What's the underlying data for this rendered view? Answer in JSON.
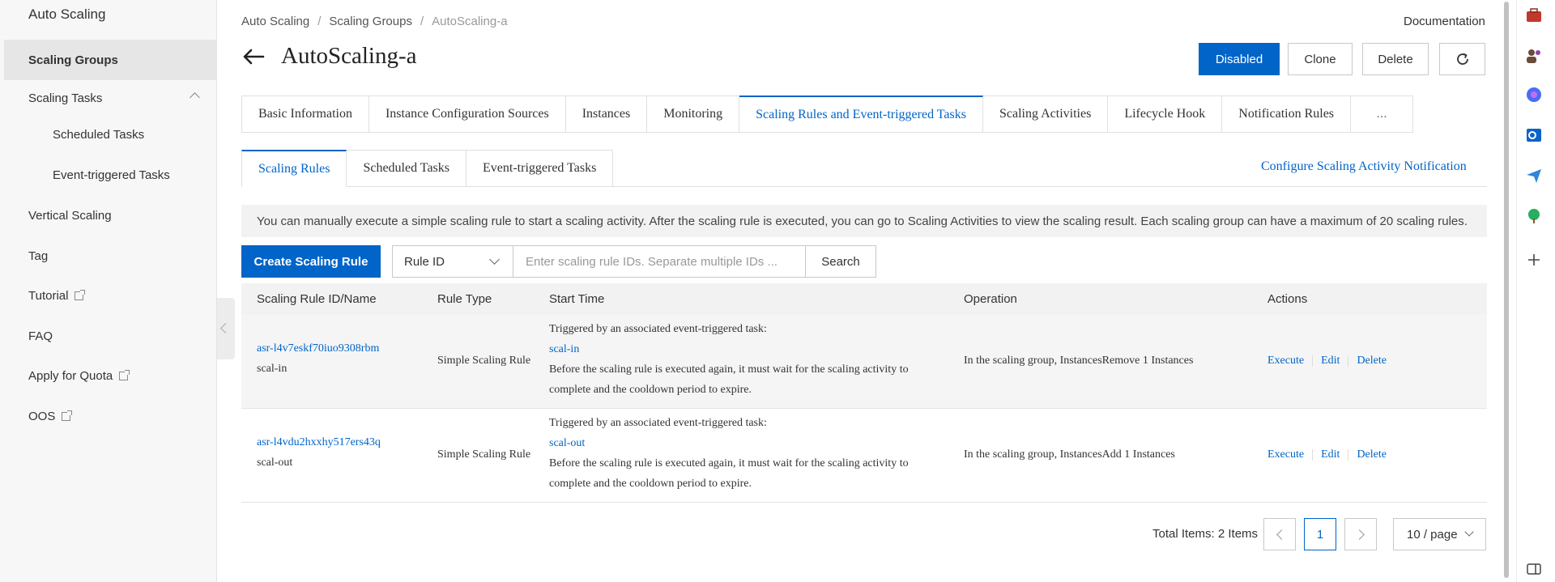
{
  "sidebar": {
    "title": "Auto Scaling",
    "items": [
      {
        "label": "Scaling Groups"
      },
      {
        "label": "Scaling Tasks"
      },
      {
        "label": "Scheduled Tasks"
      },
      {
        "label": "Event-triggered Tasks"
      },
      {
        "label": "Vertical Scaling"
      },
      {
        "label": "Tag"
      },
      {
        "label": "Tutorial"
      },
      {
        "label": "FAQ"
      },
      {
        "label": "Apply for Quota"
      },
      {
        "label": "OOS"
      }
    ]
  },
  "header": {
    "breadcrumb": [
      "Auto Scaling",
      "Scaling Groups",
      "AutoScaling-a"
    ],
    "breadcrumb_sep": "/",
    "documentation": "Documentation",
    "title": "AutoScaling-a",
    "buttons": {
      "disabled": "Disabled",
      "clone": "Clone",
      "delete": "Delete"
    }
  },
  "tabs": [
    "Basic Information",
    "Instance Configuration Sources",
    "Instances",
    "Monitoring",
    "Scaling Rules and Event-triggered Tasks",
    "Scaling Activities",
    "Lifecycle Hook",
    "Notification Rules",
    "..."
  ],
  "subtabs": [
    "Scaling Rules",
    "Scheduled Tasks",
    "Event-triggered Tasks"
  ],
  "notify_link": "Configure Scaling Activity Notification",
  "info": "You can manually execute a simple scaling rule to start a scaling activity. After the scaling rule is executed, you can go to Scaling Activities to view the scaling result. Each scaling group can have a maximum of 20 scaling rules.",
  "toolbar": {
    "create": "Create Scaling Rule",
    "select_value": "Rule ID",
    "search_placeholder": "Enter scaling rule IDs. Separate multiple IDs ...",
    "search": "Search"
  },
  "table": {
    "columns": [
      "Scaling Rule ID/Name",
      "Rule Type",
      "Start Time",
      "Operation",
      "Actions"
    ],
    "rows": [
      {
        "id": "asr-l4v7eskf70iuo9308rbm",
        "name": "scal-in",
        "type": "Simple Scaling Rule",
        "start_line1": "Triggered by an associated event-triggered task:",
        "start_task": "scal-in",
        "start_line3": "Before the scaling rule is executed again, it must wait for the scaling activity to",
        "start_line4": "complete and the cooldown period to expire.",
        "operation": "In the scaling group, InstancesRemove 1 Instances",
        "actions": [
          "Execute",
          "Edit",
          "Delete"
        ]
      },
      {
        "id": "asr-l4vdu2hxxhy517ers43q",
        "name": "scal-out",
        "type": "Simple Scaling Rule",
        "start_line1": "Triggered by an associated event-triggered task:",
        "start_task": "scal-out",
        "start_line3": "Before the scaling rule is executed again, it must wait for the scaling activity to",
        "start_line4": "complete and the cooldown period to expire.",
        "operation": "In the scaling group, InstancesAdd 1 Instances",
        "actions": [
          "Execute",
          "Edit",
          "Delete"
        ]
      }
    ]
  },
  "pagination": {
    "total": "Total Items: 2 Items",
    "current": "1",
    "page_size": "10 / page"
  },
  "colors": {
    "accent": "#0064c8"
  },
  "icons": [
    "back-arrow-icon",
    "refresh-icon",
    "external-link-icon",
    "chevron-down-icon",
    "chevron-up-icon"
  ]
}
